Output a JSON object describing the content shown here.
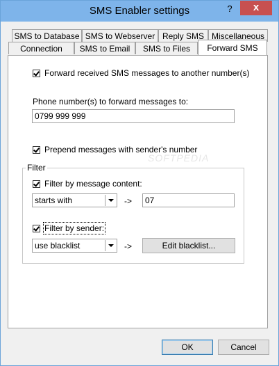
{
  "window": {
    "title": "SMS Enabler settings",
    "help_icon": "?",
    "close_icon": "x"
  },
  "tabs": {
    "row1": [
      "SMS to Database",
      "SMS to Webserver",
      "Reply SMS",
      "Miscellaneous"
    ],
    "row2": [
      "Connection",
      "SMS to Email",
      "SMS to Files",
      "Forward SMS"
    ],
    "active": "Forward SMS"
  },
  "forward": {
    "enable_label": "Forward received SMS messages to another number(s)",
    "enable_checked": true,
    "phone_label": "Phone number(s) to forward messages to:",
    "phone_value": "0799 999 999",
    "prepend_label": "Prepend messages with sender's number",
    "prepend_checked": true
  },
  "filter": {
    "group_label": "Filter",
    "content_label": "Filter by message content:",
    "content_checked": true,
    "content_mode": "starts with",
    "content_arrow": "->",
    "content_value": "07",
    "sender_label": "Filter by sender:",
    "sender_checked": true,
    "sender_mode": "use blacklist",
    "sender_arrow": "->",
    "edit_blacklist_label": "Edit blacklist..."
  },
  "footer": {
    "ok_label": "OK",
    "cancel_label": "Cancel"
  },
  "watermark": "SOFTPEDIA"
}
